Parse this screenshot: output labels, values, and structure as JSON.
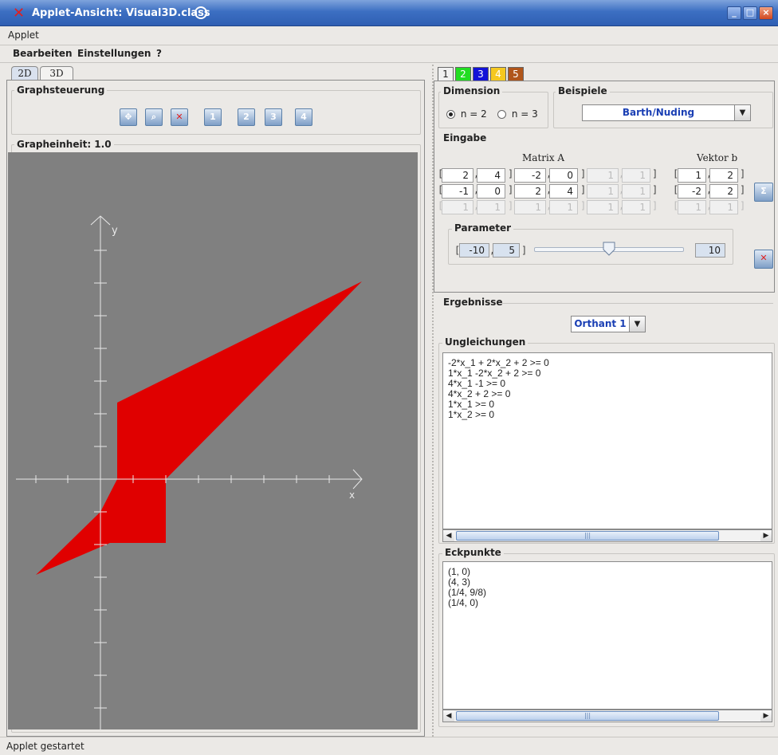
{
  "window": {
    "title": "Applet-Ansicht: Visual3D.class"
  },
  "menubar1": {
    "items": [
      "Applet"
    ]
  },
  "menubar2": {
    "items": [
      "Bearbeiten",
      "Einstellungen",
      "?"
    ]
  },
  "left": {
    "tabs": [
      "2D",
      "3D"
    ],
    "active_tab": "2D",
    "graphsteuerung_label": "Graphsteuerung",
    "toolbar_buttons": [
      "move-icon",
      "zoom-icon",
      "clear-icon",
      "view-1-icon",
      "view-2-icon",
      "view-3-icon",
      "view-4-icon"
    ],
    "toolbar_glyphs": [
      "✥",
      "⌕",
      "✕",
      "1",
      "2",
      "3",
      "4"
    ],
    "grapheinheit_label": "Grapheinheit: 1.0"
  },
  "graph": {
    "x_label": "x",
    "y_label": "y",
    "background": "#808080",
    "fill_color": "#e00000",
    "axis_color": "#e8e8e8"
  },
  "right": {
    "number_tabs": [
      {
        "label": "1",
        "color": "#f0f0f0"
      },
      {
        "label": "2",
        "color": "#22dd22"
      },
      {
        "label": "3",
        "color": "#1212d8"
      },
      {
        "label": "4",
        "color": "#f5c820"
      },
      {
        "label": "5",
        "color": "#b0551a"
      }
    ],
    "dimension": {
      "label": "Dimension",
      "options": [
        "n = 2",
        "n = 3"
      ],
      "selected": "n = 2"
    },
    "beispiele": {
      "label": "Beispiele",
      "selected": "Barth/Nuding"
    },
    "eingabe": {
      "label": "Eingabe",
      "matrix_label": "Matrix A",
      "vector_label": "Vektor b",
      "rows": [
        {
          "a": [
            "2",
            "4",
            "-2",
            "0",
            "1",
            "1"
          ],
          "b": [
            "1",
            "2"
          ]
        },
        {
          "a": [
            "-1",
            "0",
            "2",
            "4",
            "1",
            "1"
          ],
          "b": [
            "-2",
            "2"
          ]
        },
        {
          "a": [
            "1",
            "1",
            "1",
            "1",
            "1",
            "1"
          ],
          "b": [
            "1",
            "1"
          ]
        }
      ],
      "disabled_rows": [
        false,
        false,
        true
      ],
      "sum_button": "Σ"
    },
    "parameter": {
      "label": "Parameter",
      "min": "-10",
      "value": "5",
      "max": "10",
      "slider_fraction": 0.5
    },
    "ergebnisse": {
      "label": "Ergebnisse",
      "orthant": "Orthant 1"
    },
    "ungleichungen": {
      "label": "Ungleichungen",
      "lines": [
        "-2*x_1 + 2*x_2 + 2 >= 0",
        "1*x_1  -2*x_2 + 2 >= 0",
        "4*x_1  -1 >= 0",
        "4*x_2 + 2 >= 0",
        "1*x_1  >= 0",
        "1*x_2  >= 0"
      ]
    },
    "eckpunkte": {
      "label": "Eckpunkte",
      "lines": [
        "(1, 0)",
        "(4, 3)",
        "(1/4, 9/8)",
        "(1/4, 0)"
      ]
    }
  },
  "status": {
    "text": "Applet gestartet"
  }
}
